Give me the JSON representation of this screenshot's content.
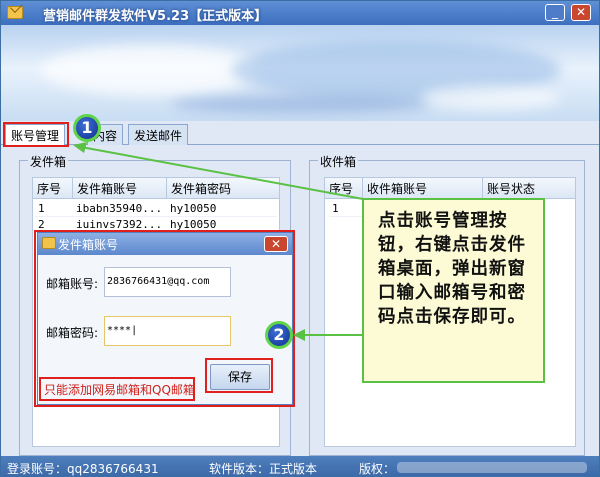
{
  "window": {
    "title": "营销邮件群发软件V5.23【正式版本】",
    "minimize_label": "_",
    "close_label": "✕"
  },
  "tabs": [
    {
      "label": "账号管理"
    },
    {
      "label": "内容"
    },
    {
      "label": "发送邮件"
    }
  ],
  "outbox": {
    "legend": "发件箱",
    "columns": [
      "序号",
      "发件箱账号",
      "发件箱密码"
    ],
    "rows": [
      {
        "no": "1",
        "account": "ibabn35940...",
        "password": "hy10050"
      },
      {
        "no": "2",
        "account": "iuinvs7392...",
        "password": "hy10050"
      }
    ]
  },
  "inbox": {
    "legend": "收件箱",
    "columns": [
      "序号",
      "收件箱账号",
      "账号状态"
    ],
    "rows": [
      {
        "no": "1"
      }
    ]
  },
  "dialog": {
    "title": "发件箱账号",
    "close_label": "✕",
    "email_label": "邮箱账号:",
    "email_value": "2836766431@qq.com",
    "password_label": "邮箱密码:",
    "password_value": "****|",
    "save_label": "保存",
    "note": "只能添加网易邮箱和QQ邮箱"
  },
  "annotations": {
    "step1": "1",
    "step2": "2",
    "callout": "点击账号管理按钮，右键点击发件箱桌面，弹出新窗口输入邮箱号和密码点击保存即可。"
  },
  "statusbar": {
    "login": "登录账号：qq2836766431",
    "version": "软件版本：正式版本",
    "copyright": "版权："
  },
  "colors": {
    "accent_red": "#e0201c",
    "accent_green": "#5ac144",
    "callout_bg": "#fdfbd5"
  }
}
